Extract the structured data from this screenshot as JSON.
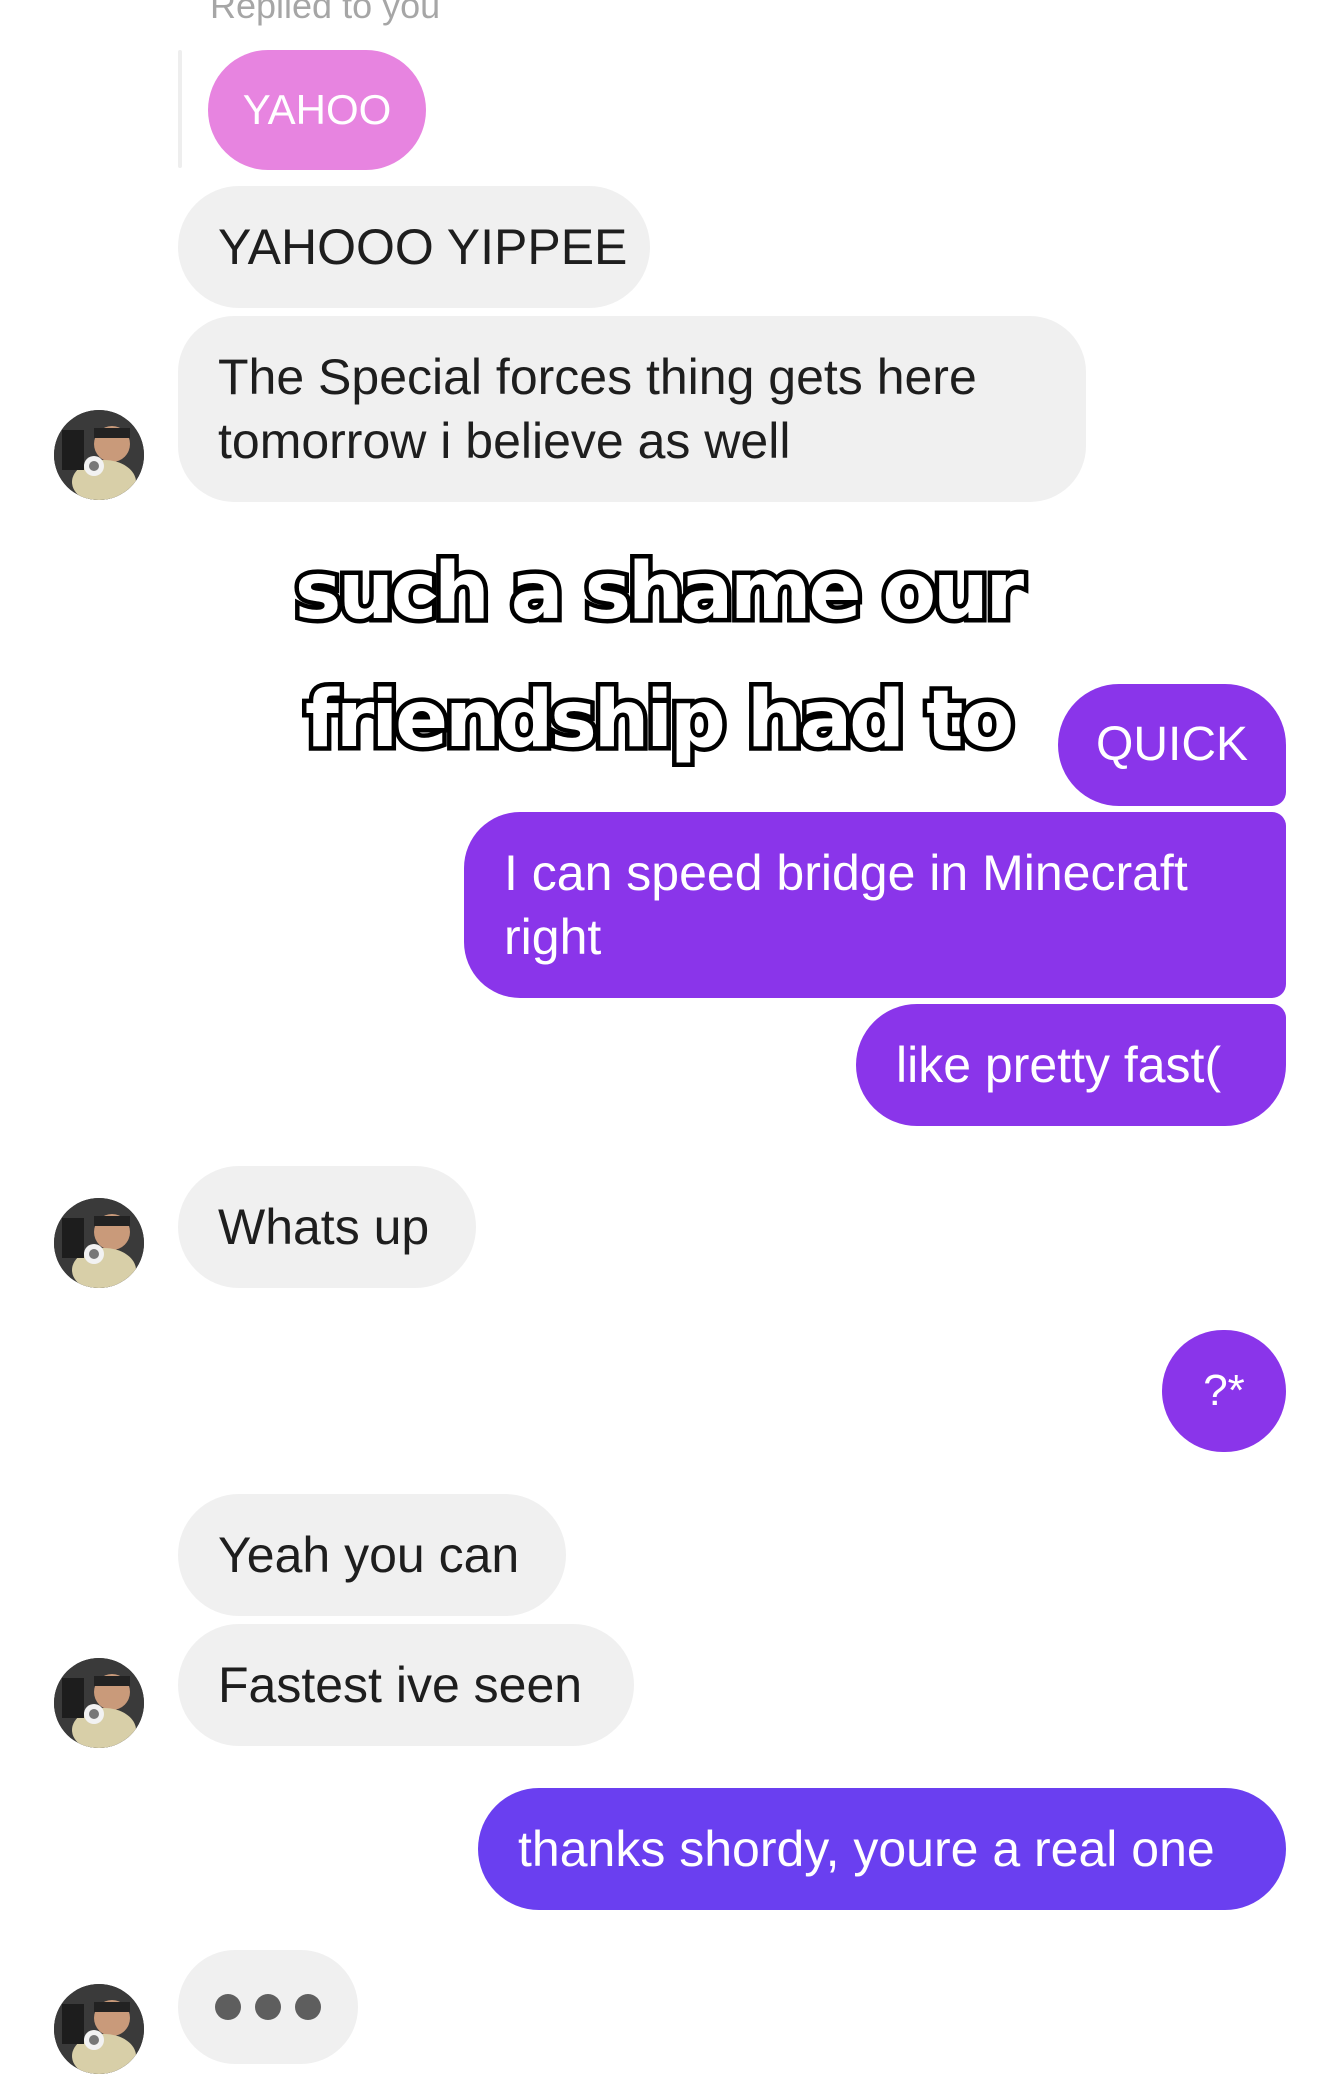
{
  "conversation": {
    "reply_label": "Replied to you",
    "reply_quote": "YAHOO",
    "messages": {
      "m1": "YAHOOO YIPPEE",
      "m2": "The Special forces thing gets here tomorrow i believe as well",
      "m3": "QUICK",
      "m4": "I can speed bridge in Minecraft right",
      "m5": "like pretty fast(",
      "m6": "Whats up",
      "m7": "?*",
      "m8": "Yeah you can",
      "m9": "Fastest ive seen",
      "m10": "thanks shordy, youre a real one"
    },
    "overlay": {
      "line1": "such a shame our",
      "line2": "friendship had to"
    }
  },
  "colors": {
    "incoming_bubble": "#f0f0f0",
    "outgoing_bubble": "#8a35ea",
    "outgoing_bubble_latest": "#6a3ff0",
    "reply_quote": "#e784e0"
  },
  "icons": {
    "avatar": "contact-avatar-photo",
    "typing": "typing-indicator-dots"
  }
}
